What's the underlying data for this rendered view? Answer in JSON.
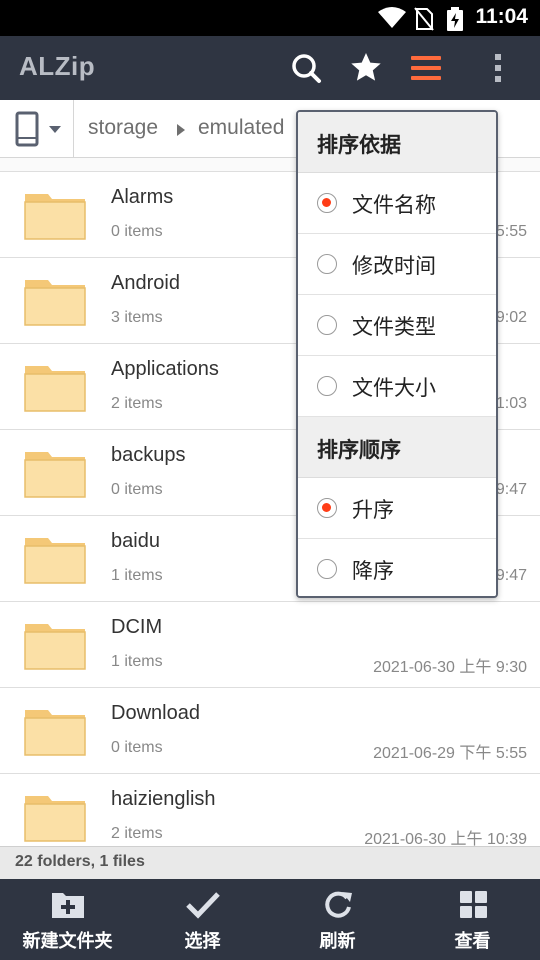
{
  "status_bar": {
    "time": "11:04",
    "icons": [
      "wifi-icon",
      "no-sim-icon",
      "battery-charging-icon"
    ]
  },
  "app_bar": {
    "title": "ALZip",
    "actions": [
      "search-icon",
      "star-icon",
      "sort-icon",
      "more-vert-icon"
    ],
    "accent": "#ff6b3d"
  },
  "path_bar": {
    "crumbs": [
      "storage",
      "emulated"
    ],
    "device": "phone-icon"
  },
  "files": [
    {
      "name": "Alarms",
      "count": "0 items",
      "date": "5:55"
    },
    {
      "name": "Android",
      "count": "3 items",
      "date": "9:02"
    },
    {
      "name": "Applications",
      "count": "2 items",
      "date": "1:03"
    },
    {
      "name": "backups",
      "count": "0 items",
      "date": "9:47"
    },
    {
      "name": "baidu",
      "count": "1 items",
      "date": "9:47"
    },
    {
      "name": "DCIM",
      "count": "1 items",
      "date": "2021-06-30 上午 9:30"
    },
    {
      "name": "Download",
      "count": "0 items",
      "date": "2021-06-29 下午 5:55"
    },
    {
      "name": "haizienglish",
      "count": "2 items",
      "date": "2021-06-30 上午 10:39"
    }
  ],
  "summary": "22 folders, 1 files",
  "bottom_bar": {
    "new_folder": "新建文件夹",
    "select": "选择",
    "refresh": "刷新",
    "view": "查看"
  },
  "sort_popup": {
    "sort_by_header": "排序依据",
    "sort_by_options": [
      {
        "label": "文件名称",
        "selected": true
      },
      {
        "label": "修改时间",
        "selected": false
      },
      {
        "label": "文件类型",
        "selected": false
      },
      {
        "label": "文件大小",
        "selected": false
      }
    ],
    "order_header": "排序顺序",
    "order_options": [
      {
        "label": "升序",
        "selected": true
      },
      {
        "label": "降序",
        "selected": false
      }
    ]
  }
}
